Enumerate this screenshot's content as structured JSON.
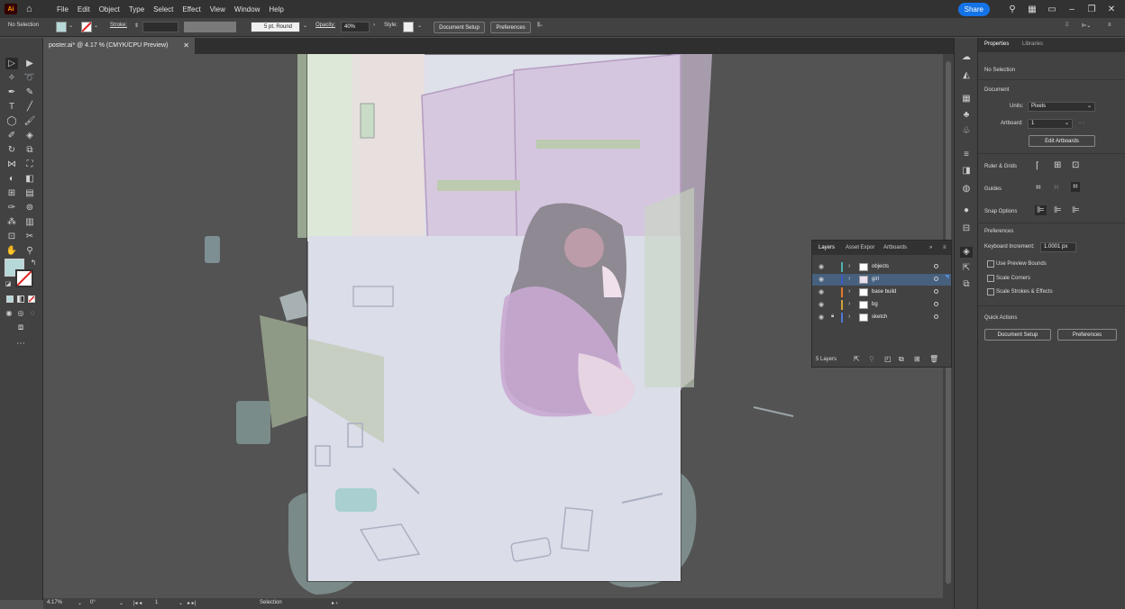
{
  "app": {
    "logo": "Ai"
  },
  "menu": [
    "File",
    "Edit",
    "Object",
    "Type",
    "Select",
    "Effect",
    "View",
    "Window",
    "Help"
  ],
  "topright": {
    "share": "Share"
  },
  "control": {
    "selection": "No Selection",
    "stroke_label": "Stroke:",
    "brush": "5 pt. Round",
    "opacity_label": "Opacity:",
    "opacity_value": "40%",
    "style_label": "Style:",
    "doc_setup": "Document Setup",
    "preferences": "Preferences"
  },
  "document": {
    "tab_title": "poster.ai* @ 4.17 % (CMYK/CPU Preview)"
  },
  "status": {
    "zoom": "4.17%",
    "rotation": "0°",
    "artboard": "1",
    "tool": "Selection"
  },
  "properties": {
    "tabs": [
      "Properties",
      "Libraries"
    ],
    "selection": "No Selection",
    "document_heading": "Document",
    "units_label": "Units:",
    "units_value": "Pixels",
    "artboard_label": "Artboard:",
    "artboard_value": "1",
    "edit_artboards": "Edit Artboards",
    "ruler_grids": "Ruler & Grids",
    "guides": "Guides",
    "snap_options": "Snap Options",
    "preferences_heading": "Preferences",
    "keyboard_increment_label": "Keyboard Increment:",
    "keyboard_increment_value": "1.0001 px",
    "use_preview_bounds": "Use Preview Bounds",
    "scale_corners": "Scale Corners",
    "scale_strokes": "Scale Strokes & Effects",
    "quick_actions": "Quick Actions",
    "doc_setup": "Document Setup",
    "preferences": "Preferences"
  },
  "layers_panel": {
    "tabs": [
      "Layers",
      "Asset Expor",
      "Artboards"
    ],
    "layers": [
      {
        "name": "objects",
        "color": "#4fb0ad",
        "active": false,
        "locked": false
      },
      {
        "name": "girl",
        "color": "#3c5cc4",
        "active": true,
        "locked": false
      },
      {
        "name": "base build",
        "color": "#e07a2a",
        "active": false,
        "locked": false
      },
      {
        "name": "bg",
        "color": "#d2a040",
        "active": false,
        "locked": false
      },
      {
        "name": "sketch",
        "color": "#4f78d8",
        "active": false,
        "locked": true
      }
    ],
    "count": "5 Layers"
  },
  "colors": {
    "fill": "#b6d8d8",
    "accent": "#1473e6"
  }
}
